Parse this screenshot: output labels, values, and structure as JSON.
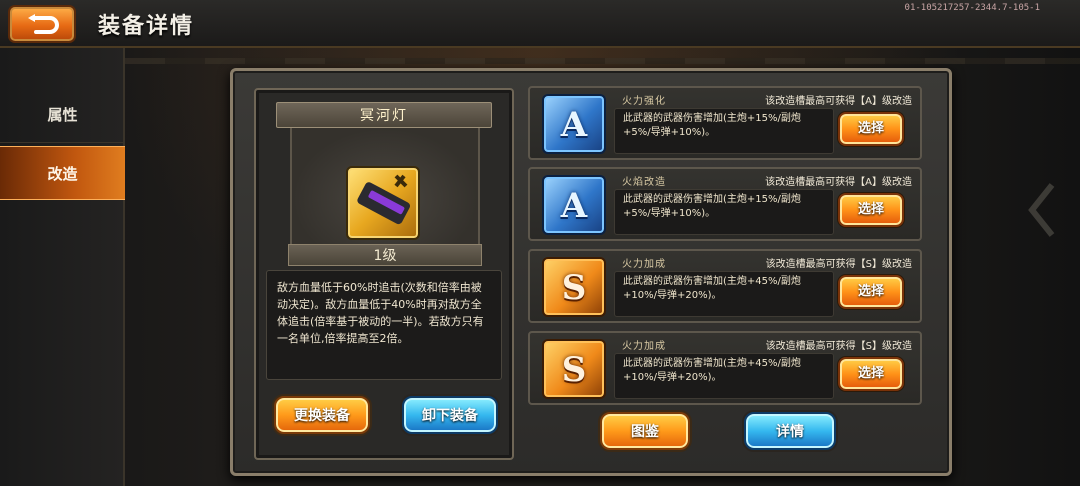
{
  "header": {
    "title": "装备详情",
    "version": "01-105217257-2344.7-105-1"
  },
  "sidenav": {
    "items": [
      {
        "label": "属性",
        "active": false
      },
      {
        "label": "改造",
        "active": true
      }
    ]
  },
  "equipment": {
    "name": "冥河灯",
    "level": "1级",
    "description": "敌方血量低于60%时追击(次数和倍率由被动决定)。敌方血量低于40%时再对敌方全体追击(倍率基于被动的一半)。若敌方只有一名单位,倍率提高至2倍。",
    "replace_button": "更换装备",
    "unequip_button": "卸下装备"
  },
  "mods": [
    {
      "grade": "A",
      "name": "火力强化",
      "hint": "该改造槽最高可获得【A】级改造",
      "effect": "此武器的武器伤害增加(主炮+15%/副炮+5%/导弹+10%)。",
      "button": "选择"
    },
    {
      "grade": "A",
      "name": "火焰改造",
      "hint": "该改造槽最高可获得【A】级改造",
      "effect": "此武器的武器伤害增加(主炮+15%/副炮+5%/导弹+10%)。",
      "button": "选择"
    },
    {
      "grade": "S",
      "name": "火力加成",
      "hint": "该改造槽最高可获得【S】级改造",
      "effect": "此武器的武器伤害增加(主炮+45%/副炮+10%/导弹+20%)。",
      "button": "选择"
    },
    {
      "grade": "S",
      "name": "火力加成",
      "hint": "该改造槽最高可获得【S】级改造",
      "effect": "此武器的武器伤害增加(主炮+45%/副炮+10%/导弹+20%)。",
      "button": "选择"
    }
  ],
  "footer": {
    "codex_button": "图鉴",
    "details_button": "详情"
  },
  "colors": {
    "accent_orange": "#ff9a1a",
    "accent_blue": "#35b8ef",
    "panel": "#3b3a37"
  }
}
